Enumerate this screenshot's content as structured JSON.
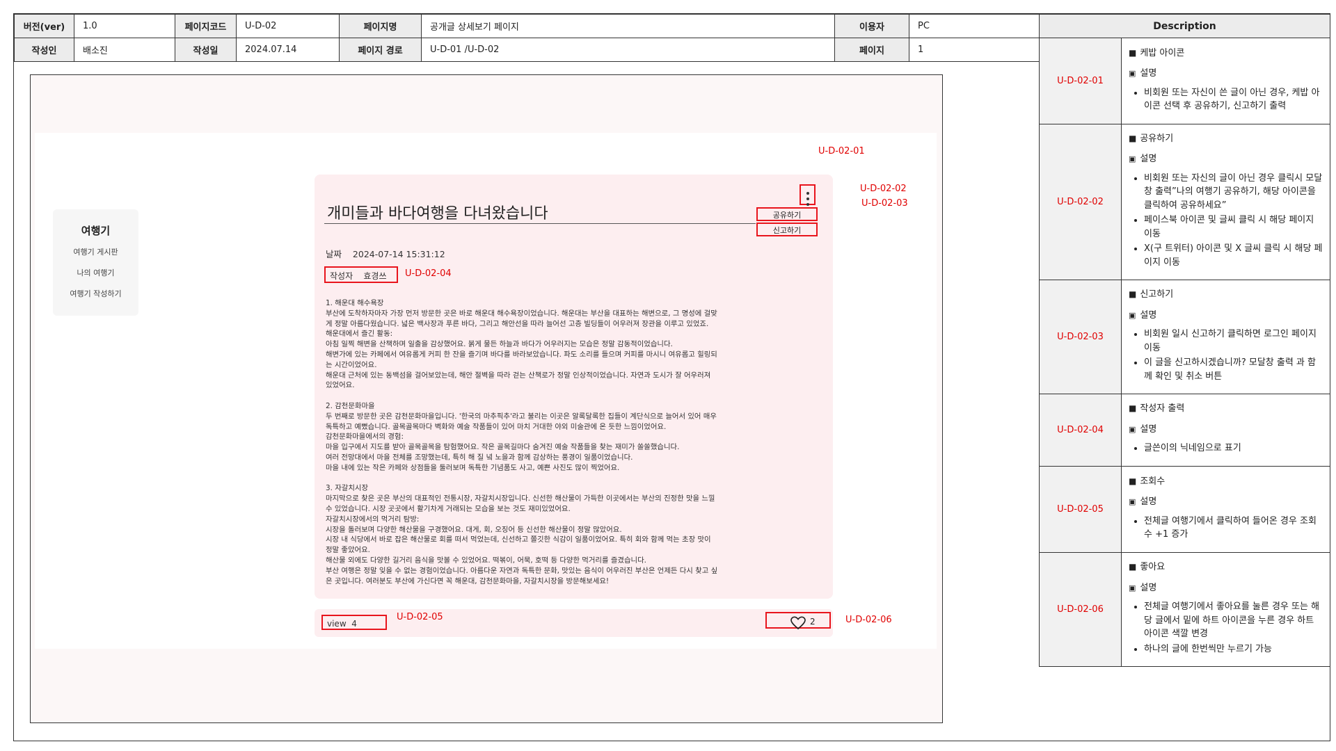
{
  "meta": {
    "version_label": "버전(ver)",
    "version_value": "1.0",
    "page_code_label": "페이지코드",
    "page_code_value": "U-D-02",
    "page_name_label": "페이지명",
    "page_name_value": "공개글 상세보기 페이지",
    "user_label": "이용자",
    "user_value": "PC",
    "author_label": "작성인",
    "author_value": "배소진",
    "date_label": "작성일",
    "date_value": "2024.07.14",
    "path_label": "페이지 경로",
    "path_value": "U-D-01 /U-D-02",
    "page_label": "페이지",
    "page_value": "1"
  },
  "sidebar": {
    "title": "여행기",
    "items": [
      "여행기 게시판",
      "나의 여행기",
      "여행기 작성하기"
    ]
  },
  "post": {
    "title": "개미들과 바다여행을 다녀왔습니다",
    "menu": {
      "share": "공유하기",
      "report": "신고하기"
    },
    "date_label": "날짜",
    "date_value": "2024-07-14 15:31:12",
    "writer_label": "작성자",
    "writer_value": "효경쓰",
    "body": "1. 해운대 해수욕장\n부산에 도착하자마자 가장 먼저 방문한 곳은 바로 해운대 해수욕장이었습니다. 해운대는 부산을 대표하는 해변으로, 그 명성에 걸맞\n게 정말 아름다웠습니다. 넓은 백사장과 푸른 바다, 그리고 해안선을 따라 늘어선 고층 빌딩들이 어우러져 장관을 이루고 있었죠.\n해운대에서 즐긴 활동:\n아침 일찍 해변을 산책하며 일출을 감상했어요. 붉게 물든 하늘과 바다가 어우러지는 모습은 정말 감동적이었습니다.\n해변가에 있는 카페에서 여유롭게 커피 한 잔을 즐기며 바다를 바라보았습니다. 파도 소리를 들으며 커피를 마시니 여유롭고 힐링되\n는 시간이었어요.\n해운대 근처에 있는 동백섬을 걸어보았는데, 해안 절벽을 따라 걷는 산책로가 정말 인상적이었습니다. 자연과 도시가 잘 어우러져\n있었어요.\n\n2. 감천문화마을\n두 번째로 방문한 곳은 감천문화마을입니다. '한국의 마추픽추'라고 불리는 이곳은 알록달록한 집들이 계단식으로 늘어서 있어 매우\n독특하고 예뻤습니다. 골목골목마다 벽화와 예술 작품들이 있어 마치 거대한 야외 미술관에 온 듯한 느낌이었어요.\n감천문화마을에서의 경험:\n마을 입구에서 지도를 받아 골목골목을 탐험했어요. 작은 골목길마다 숨겨진 예술 작품들을 찾는 재미가 쏠쏠했습니다.\n여러 전망대에서 마을 전체를 조망했는데, 특히 해 질 녘 노을과 함께 감상하는 풍경이 일품이었습니다.\n마을 내에 있는 작은 카페와 상점들을 둘러보며 독특한 기념품도 사고, 예쁜 사진도 많이 찍었어요.\n\n3. 자갈치시장\n마지막으로 찾은 곳은 부산의 대표적인 전통시장, 자갈치시장입니다. 신선한 해산물이 가득한 이곳에서는 부산의 진정한 맛을 느낄\n수 있었습니다. 시장 곳곳에서 활기차게 거래되는 모습을 보는 것도 재미있었어요.\n자갈치시장에서의 먹거리 탐방:\n시장을 돌러보며 다양한 해산물을 구경했어요. 대게, 회, 오징어 등 신선한 해산물이 정말 많았어요.\n시장 내 식당에서 바로 잡은 해산물로 회를 떠서 먹었는데, 신선하고 쫄깃한 식감이 일품이었어요. 특히 회와 함께 먹는 초장 맛이\n정말 좋았어요.\n해산물 외에도 다양한 길거리 음식을 맛볼 수 있었어요. 떡볶이, 어묵, 호떡 등 다양한 먹거리를 즐겼습니다.\n부산 여행은 정말 잊을 수 없는 경험이었습니다. 아름다운 자연과 독특한 문화, 맛있는 음식이 어우러진 부산은 언제든 다시 찾고 싶\n은 곳입니다. 여러분도 부산에 가신다면 꼭 해운대, 감천문화마을, 자갈치시장을 방문해보세요!",
    "view_label": "view",
    "view_count": "4",
    "like_count": "2"
  },
  "annotations": {
    "a01": "U-D-02-01",
    "a02": "U-D-02-02",
    "a03": "U-D-02-03",
    "a04": "U-D-02-04",
    "a05": "U-D-02-05",
    "a06": "U-D-02-06"
  },
  "description": {
    "header": "Description",
    "sub_label": "설명",
    "rows": [
      {
        "id": "U-D-02-01",
        "title": "케밥 아이콘",
        "bullets": [
          "비회원 또는 자신이 쓴 글이 아닌 경우, 케밥 아이콘 선택 후 공유하기, 신고하기 출력"
        ]
      },
      {
        "id": "U-D-02-02",
        "title": "공유하기",
        "bullets": [
          "비회원 또는 자신의 글이 아닌 경우 클릭시 모달창 출력”나의 여행기 공유하기, 해당 아이콘을 클릭하여 공유하세요”",
          "페이스북 아이콘 및 글씨 클릭 시 해당 페이지 이동",
          "X(구 트위터) 아이콘 및 X 글씨 클릭 시 해당 페이지 이동"
        ]
      },
      {
        "id": "U-D-02-03",
        "title": "신고하기",
        "bullets": [
          "비회원 일시 신고하기 클릭하면 로그인 페이지 이동",
          "이 글을 신고하시겠습니까? 모달창 출력 과 함께 확인 및 취소 버튼"
        ]
      },
      {
        "id": "U-D-02-04",
        "title": "작성자 출력",
        "bullets": [
          "글쓴이의 닉네임으로 표기"
        ]
      },
      {
        "id": "U-D-02-05",
        "title": "조회수",
        "bullets": [
          "전체글 여행기에서 클릭하여 들어온 경우 조회수 +1 증가"
        ]
      },
      {
        "id": "U-D-02-06",
        "title": "좋아요",
        "bullets": [
          "전체글 여행기에서 좋아요를 눌른 경우 또는 해당 글에서 밑에 하트 아이콘을 누른 경우 하트 아이콘 색깔 변경",
          "하나의 글에 한번씩만 누르기 가능"
        ]
      }
    ]
  },
  "colors": {
    "annotation": "#e00000",
    "card": "#fdeef0",
    "label_bg": "#ececec"
  }
}
